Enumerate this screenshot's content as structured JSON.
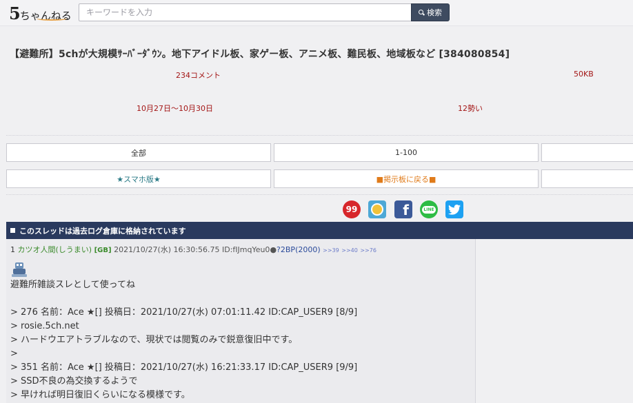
{
  "header": {
    "logo_main": "5",
    "logo_sub": "ちゃんねる",
    "search_placeholder": "キーワードを入力",
    "search_button": "検索"
  },
  "thread": {
    "title": "【避難所】5chが大規模ｻｰﾊﾞｰﾀﾞｳﾝ。地下アイドル板、家ゲー板、アニメ板、難民板、地域板など [384080854]",
    "comments": "234コメント",
    "size": "50KB",
    "period": "10月27日～10月30日",
    "momentum": "12勢い"
  },
  "nav": {
    "all": "全部",
    "range": "1-100",
    "smartphone": "★スマホ版★",
    "back": "■掲示板に戻る■"
  },
  "share": {
    "icons": [
      "99-share-icon",
      "hatena-share-icon",
      "facebook-share-icon",
      "line-share-icon",
      "twitter-share-icon"
    ],
    "nine_label": "99",
    "fb_label": "f",
    "line_label": "LINE"
  },
  "archive_notice": "このスレッドは過去ログ倉庫に格納されています",
  "post": {
    "number": "1",
    "name": "カツオ人間(しうまい)",
    "tag": "[GB]",
    "datetime": "2021/10/27(水) 16:30:56.75 ID:fIJmqYeu0",
    "be": "?2BP(2000)",
    "links": [
      ">>39",
      ">>40",
      ">>76"
    ],
    "body": "避難所雑談スレとして使ってね\n\n> 276 名前：Ace ★[] 投稿日：2021/10/27(水) 07:01:11.42 ID:CAP_USER9 [8/9]\n> rosie.5ch.net\n> ハードウエアトラブルなので、現状では閲覧のみで鋭意復旧中です。\n>\n> 351 名前：Ace ★[] 投稿日：2021/10/27(水) 16:21:33.17 ID:CAP_USER9 [9/9]\n> SSD不良の為交換するようで\n> 早ければ明日復旧くらいになる模様です。"
  },
  "colors": {
    "archive_bar": "#2a3a5e",
    "meta_red": "#a31515",
    "name_green": "#3a8a2a",
    "search_button": "#3e4b60"
  }
}
